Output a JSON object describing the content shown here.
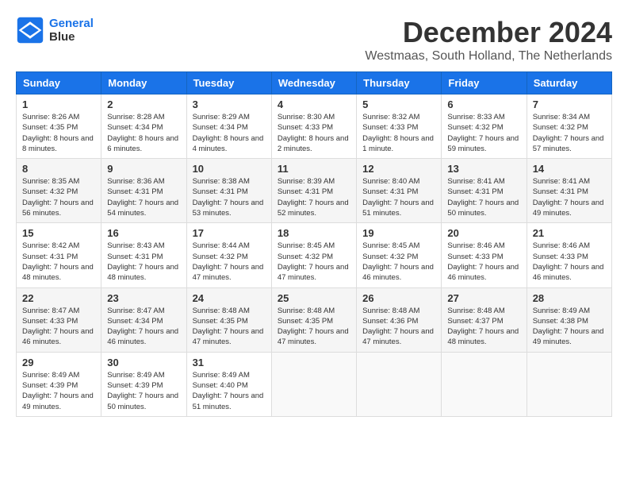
{
  "header": {
    "logo_line1": "General",
    "logo_line2": "Blue",
    "month_year": "December 2024",
    "location": "Westmaas, South Holland, The Netherlands"
  },
  "weekdays": [
    "Sunday",
    "Monday",
    "Tuesday",
    "Wednesday",
    "Thursday",
    "Friday",
    "Saturday"
  ],
  "weeks": [
    [
      {
        "day": "1",
        "sunrise": "Sunrise: 8:26 AM",
        "sunset": "Sunset: 4:35 PM",
        "daylight": "Daylight: 8 hours and 8 minutes."
      },
      {
        "day": "2",
        "sunrise": "Sunrise: 8:28 AM",
        "sunset": "Sunset: 4:34 PM",
        "daylight": "Daylight: 8 hours and 6 minutes."
      },
      {
        "day": "3",
        "sunrise": "Sunrise: 8:29 AM",
        "sunset": "Sunset: 4:34 PM",
        "daylight": "Daylight: 8 hours and 4 minutes."
      },
      {
        "day": "4",
        "sunrise": "Sunrise: 8:30 AM",
        "sunset": "Sunset: 4:33 PM",
        "daylight": "Daylight: 8 hours and 2 minutes."
      },
      {
        "day": "5",
        "sunrise": "Sunrise: 8:32 AM",
        "sunset": "Sunset: 4:33 PM",
        "daylight": "Daylight: 8 hours and 1 minute."
      },
      {
        "day": "6",
        "sunrise": "Sunrise: 8:33 AM",
        "sunset": "Sunset: 4:32 PM",
        "daylight": "Daylight: 7 hours and 59 minutes."
      },
      {
        "day": "7",
        "sunrise": "Sunrise: 8:34 AM",
        "sunset": "Sunset: 4:32 PM",
        "daylight": "Daylight: 7 hours and 57 minutes."
      }
    ],
    [
      {
        "day": "8",
        "sunrise": "Sunrise: 8:35 AM",
        "sunset": "Sunset: 4:32 PM",
        "daylight": "Daylight: 7 hours and 56 minutes."
      },
      {
        "day": "9",
        "sunrise": "Sunrise: 8:36 AM",
        "sunset": "Sunset: 4:31 PM",
        "daylight": "Daylight: 7 hours and 54 minutes."
      },
      {
        "day": "10",
        "sunrise": "Sunrise: 8:38 AM",
        "sunset": "Sunset: 4:31 PM",
        "daylight": "Daylight: 7 hours and 53 minutes."
      },
      {
        "day": "11",
        "sunrise": "Sunrise: 8:39 AM",
        "sunset": "Sunset: 4:31 PM",
        "daylight": "Daylight: 7 hours and 52 minutes."
      },
      {
        "day": "12",
        "sunrise": "Sunrise: 8:40 AM",
        "sunset": "Sunset: 4:31 PM",
        "daylight": "Daylight: 7 hours and 51 minutes."
      },
      {
        "day": "13",
        "sunrise": "Sunrise: 8:41 AM",
        "sunset": "Sunset: 4:31 PM",
        "daylight": "Daylight: 7 hours and 50 minutes."
      },
      {
        "day": "14",
        "sunrise": "Sunrise: 8:41 AM",
        "sunset": "Sunset: 4:31 PM",
        "daylight": "Daylight: 7 hours and 49 minutes."
      }
    ],
    [
      {
        "day": "15",
        "sunrise": "Sunrise: 8:42 AM",
        "sunset": "Sunset: 4:31 PM",
        "daylight": "Daylight: 7 hours and 48 minutes."
      },
      {
        "day": "16",
        "sunrise": "Sunrise: 8:43 AM",
        "sunset": "Sunset: 4:31 PM",
        "daylight": "Daylight: 7 hours and 48 minutes."
      },
      {
        "day": "17",
        "sunrise": "Sunrise: 8:44 AM",
        "sunset": "Sunset: 4:32 PM",
        "daylight": "Daylight: 7 hours and 47 minutes."
      },
      {
        "day": "18",
        "sunrise": "Sunrise: 8:45 AM",
        "sunset": "Sunset: 4:32 PM",
        "daylight": "Daylight: 7 hours and 47 minutes."
      },
      {
        "day": "19",
        "sunrise": "Sunrise: 8:45 AM",
        "sunset": "Sunset: 4:32 PM",
        "daylight": "Daylight: 7 hours and 46 minutes."
      },
      {
        "day": "20",
        "sunrise": "Sunrise: 8:46 AM",
        "sunset": "Sunset: 4:33 PM",
        "daylight": "Daylight: 7 hours and 46 minutes."
      },
      {
        "day": "21",
        "sunrise": "Sunrise: 8:46 AM",
        "sunset": "Sunset: 4:33 PM",
        "daylight": "Daylight: 7 hours and 46 minutes."
      }
    ],
    [
      {
        "day": "22",
        "sunrise": "Sunrise: 8:47 AM",
        "sunset": "Sunset: 4:33 PM",
        "daylight": "Daylight: 7 hours and 46 minutes."
      },
      {
        "day": "23",
        "sunrise": "Sunrise: 8:47 AM",
        "sunset": "Sunset: 4:34 PM",
        "daylight": "Daylight: 7 hours and 46 minutes."
      },
      {
        "day": "24",
        "sunrise": "Sunrise: 8:48 AM",
        "sunset": "Sunset: 4:35 PM",
        "daylight": "Daylight: 7 hours and 47 minutes."
      },
      {
        "day": "25",
        "sunrise": "Sunrise: 8:48 AM",
        "sunset": "Sunset: 4:35 PM",
        "daylight": "Daylight: 7 hours and 47 minutes."
      },
      {
        "day": "26",
        "sunrise": "Sunrise: 8:48 AM",
        "sunset": "Sunset: 4:36 PM",
        "daylight": "Daylight: 7 hours and 47 minutes."
      },
      {
        "day": "27",
        "sunrise": "Sunrise: 8:48 AM",
        "sunset": "Sunset: 4:37 PM",
        "daylight": "Daylight: 7 hours and 48 minutes."
      },
      {
        "day": "28",
        "sunrise": "Sunrise: 8:49 AM",
        "sunset": "Sunset: 4:38 PM",
        "daylight": "Daylight: 7 hours and 49 minutes."
      }
    ],
    [
      {
        "day": "29",
        "sunrise": "Sunrise: 8:49 AM",
        "sunset": "Sunset: 4:39 PM",
        "daylight": "Daylight: 7 hours and 49 minutes."
      },
      {
        "day": "30",
        "sunrise": "Sunrise: 8:49 AM",
        "sunset": "Sunset: 4:39 PM",
        "daylight": "Daylight: 7 hours and 50 minutes."
      },
      {
        "day": "31",
        "sunrise": "Sunrise: 8:49 AM",
        "sunset": "Sunset: 4:40 PM",
        "daylight": "Daylight: 7 hours and 51 minutes."
      },
      null,
      null,
      null,
      null
    ]
  ]
}
